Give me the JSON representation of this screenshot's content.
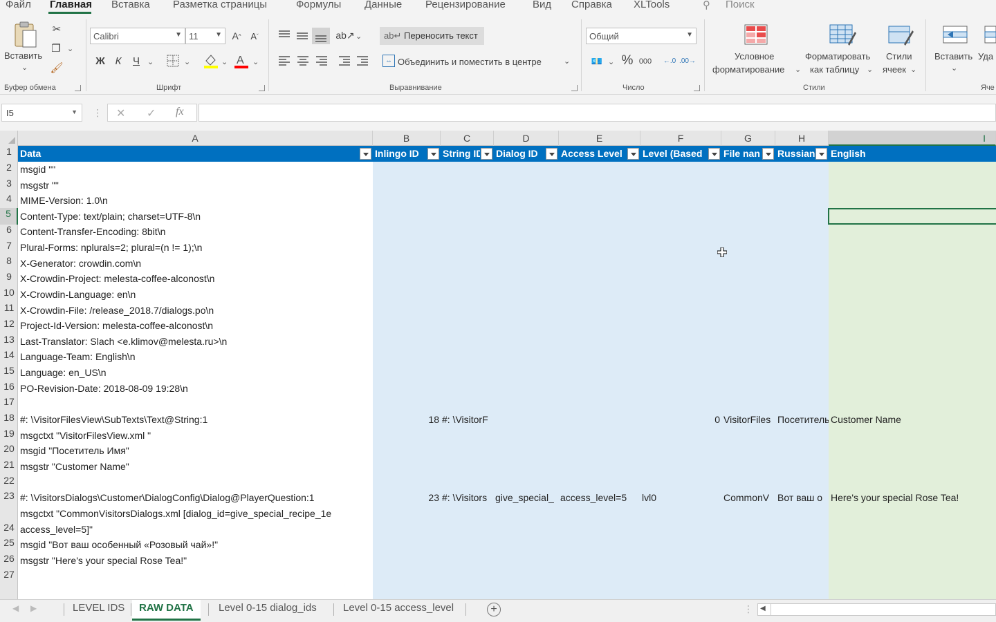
{
  "menu": {
    "file": "Файл",
    "home": "Главная",
    "insert": "Вставка",
    "layout": "Разметка страницы",
    "formulas": "Формулы",
    "data": "Данные",
    "review": "Рецензирование",
    "view": "Вид",
    "help": "Справка",
    "xltools": "XLTools",
    "search": "Поиск"
  },
  "ribbon": {
    "paste_label": "Вставить",
    "clipboard_group": "Буфер обмена",
    "font_name": "Calibri",
    "font_size": "11",
    "bold": "Ж",
    "italic": "К",
    "underline": "Ч",
    "font_group": "Шрифт",
    "wrap_text": "Переносить текст",
    "merge_center": "Объединить и поместить в центре",
    "alignment_group": "Выравнивание",
    "number_format": "Общий",
    "percent": "%",
    "thousands": "000",
    "number_group": "Число",
    "cond_format_1": "Условное",
    "cond_format_2": "форматирование",
    "format_table_1": "Форматировать",
    "format_table_2": "как таблицу",
    "cell_styles_1": "Стили",
    "cell_styles_2": "ячеек",
    "styles_group": "Стили",
    "insert_label": "Вставить",
    "delete_label": "Уда",
    "cells_group": "Яче",
    "accent_color": "#217346"
  },
  "formula_bar": {
    "name_box": "I5",
    "cancel": "✕",
    "enter": "✓",
    "fx": "fx",
    "formula": ""
  },
  "columns": [
    "A",
    "B",
    "C",
    "D",
    "E",
    "F",
    "G",
    "H",
    "I"
  ],
  "table_headers": [
    "Data",
    "Inlingo ID",
    "String ID",
    "Dialog ID",
    "Access Level",
    "Level (Based",
    "File nan",
    "Russian",
    "English"
  ],
  "table_header_color": "#0070c0",
  "rows": [
    "1",
    "2",
    "3",
    "4",
    "5",
    "6",
    "7",
    "8",
    "9",
    "10",
    "11",
    "12",
    "13",
    "14",
    "15",
    "16",
    "17",
    "18",
    "19",
    "20",
    "21",
    "22",
    "23",
    "24",
    "25",
    "26",
    "27"
  ],
  "cells": {
    "a2": "msgid \"\"",
    "a3": "msgstr \"\"",
    "a4": "MIME-Version: 1.0\\n",
    "a5": "Content-Type: text/plain; charset=UTF-8\\n",
    "a6": "Content-Transfer-Encoding: 8bit\\n",
    "a7": "Plural-Forms: nplurals=2; plural=(n != 1);\\n",
    "a8": "X-Generator: crowdin.com\\n",
    "a9": "X-Crowdin-Project: melesta-coffee-alconost\\n",
    "a10": "X-Crowdin-Language: en\\n",
    "a11": "X-Crowdin-File: /release_2018.7/dialogs.po\\n",
    "a12": "Project-Id-Version: melesta-coffee-alconost\\n",
    "a13": "Last-Translator: Slach <e.klimov@melesta.ru>\\n",
    "a14": "Language-Team: English\\n",
    "a15": "Language: en_US\\n",
    "a16": "PO-Revision-Date: 2018-08-09 19:28\\n",
    "a18": "#: \\VisitorFilesView\\SubTexts\\Text@String:1",
    "a19": "msgctxt \"VisitorFilesView.xml \"",
    "a20": "msgid \"Посетитель Имя\"",
    "a21": "msgstr \"Customer Name\"",
    "a23": "#: \\VisitorsDialogs\\Customer\\DialogConfig\\Dialog@PlayerQuestion:1",
    "a24_line1": "msgctxt \"CommonVisitorsDialogs.xml [dialog_id=give_special_recipe_1e",
    "a24_line2": "access_level=5]\"",
    "a25": "msgid \"Вот ваш особенный «Розовый чай»!\"",
    "a26": "msgstr \"Here's your special Rose Tea!\"",
    "b18": "18",
    "c18": "#: \\VisitorF",
    "f18": "0",
    "g18": "VisitorFiles",
    "h18": "Посетитель",
    "i18": "Customer Name",
    "b23": "23",
    "c23": "#: \\Visitors",
    "d23": "give_special_",
    "e23": "access_level=5",
    "f23": "lvl0",
    "g23": "CommonV",
    "h23": "Вот ваш о",
    "i23": "Here's your special Rose Tea!"
  },
  "sheet_tabs": [
    "LEVEL IDS",
    "RAW DATA",
    "Level 0-15 dialog_ids",
    "Level 0-15 access_level"
  ],
  "add_sheet": "+"
}
